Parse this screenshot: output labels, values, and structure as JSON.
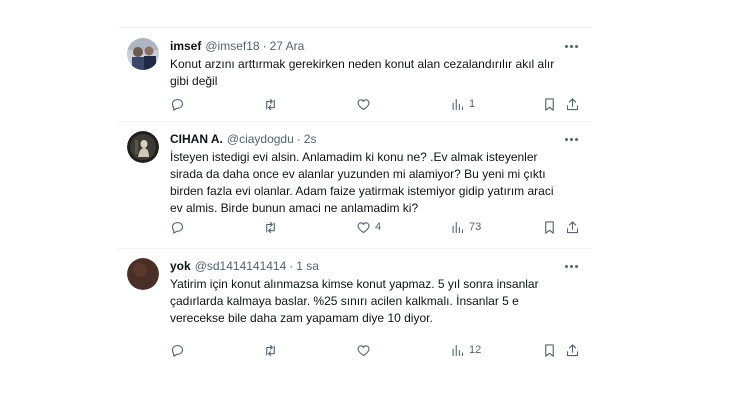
{
  "tweets": [
    {
      "name": "imsef",
      "handle": "@imsef18",
      "time": "27 Ara",
      "text": "Konut arzını arttırmak gerekirken neden konut alan cezalandırılır akıl alır gibi değil",
      "replies": "",
      "retweets": "",
      "likes": "",
      "views": "1",
      "avatar_color": "#7d8aa0"
    },
    {
      "name": "CIHAN A.",
      "handle": "@ciaydogdu",
      "time": "2s",
      "text": "İsteyen istedigi evi alsin. Anlamadim ki konu ne? .Ev almak isteyenler sirada da daha once ev alanlar yuzunden mi alamiyor? Bu yeni mi çıktı birden fazla evi olanlar. Adam faize yatirmak istemiyor gidip yatırım araci ev almis. Birde bunun amaci ne anlamadim ki?",
      "replies": "",
      "retweets": "",
      "likes": "4",
      "views": "73",
      "avatar_color": "#2b2b2b"
    },
    {
      "name": "yok",
      "handle": "@sd1414141414",
      "time": "1 sa",
      "text": "Yatirim için konut alınmazsa kimse konut yapmaz. 5 yıl sonra insanlar çadırlarda kalmaya baslar. %25 sınırı acilen kalkmalı. İnsanlar 5 e verecekse bile daha zam yapamam diye 10 diyor.",
      "replies": "",
      "retweets": "",
      "likes": "",
      "views": "12",
      "avatar_color": "#4a2f26"
    }
  ],
  "separator": "·",
  "icons": [
    "reply-icon",
    "retweet-icon",
    "like-icon",
    "views-icon",
    "bookmark-icon",
    "share-icon",
    "more-icon"
  ]
}
